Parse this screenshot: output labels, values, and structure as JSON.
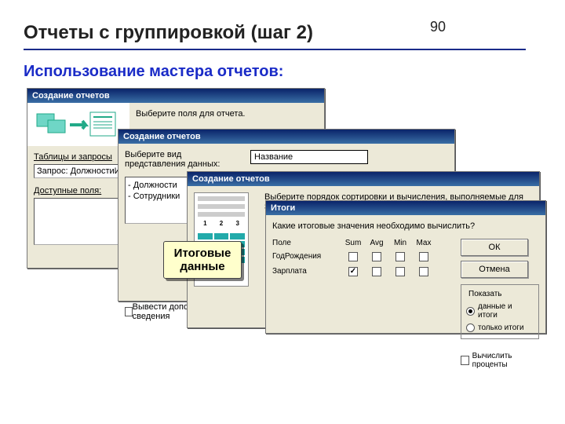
{
  "slide": {
    "title": "Отчеты с группировкой (шаг 2)",
    "page_number": "90",
    "subtitle": "Использование мастера отчетов:"
  },
  "window1": {
    "title": "Создание отчетов",
    "instruction": "Выберите поля для отчета.",
    "tables_label": "Таблицы и запросы",
    "query_selected": "Запрос: ДолжностиИСо",
    "available_label": "Доступные поля:"
  },
  "window2": {
    "title": "Создание отчетов",
    "instruction": "Выберите вид представления данных:",
    "tree": [
      "- Должности",
      "- Сотрудники"
    ],
    "name_field": "Название",
    "show_details_label": " Вывести дополнительные сведения"
  },
  "window3": {
    "title": "Создание отчетов",
    "instruction": "Выберите порядок сортировки и вычисления, выполняемые для записей.",
    "preview_nums": [
      "1",
      "2",
      "3"
    ]
  },
  "totals_window": {
    "title": "Итоги",
    "question": "Какие итоговые значения необходимо вычислить?",
    "columns": [
      "Sum",
      "Avg",
      "Min",
      "Max"
    ],
    "rows": [
      {
        "field": "ГодРождения",
        "sum": false,
        "avg": false,
        "min": false,
        "max": false
      },
      {
        "field": "Зарплата",
        "sum": true,
        "avg": false,
        "min": false,
        "max": false
      }
    ],
    "ok_label": "ОК",
    "cancel_label": "Отмена",
    "show_group": {
      "legend": "Показать",
      "opt_data_and_totals": " данные и итоги",
      "opt_totals_only": " только итоги",
      "selected": "data_and_totals"
    },
    "percent_label": " Вычислить проценты"
  },
  "callout": {
    "line1": "Итоговые",
    "line2": "данные"
  }
}
